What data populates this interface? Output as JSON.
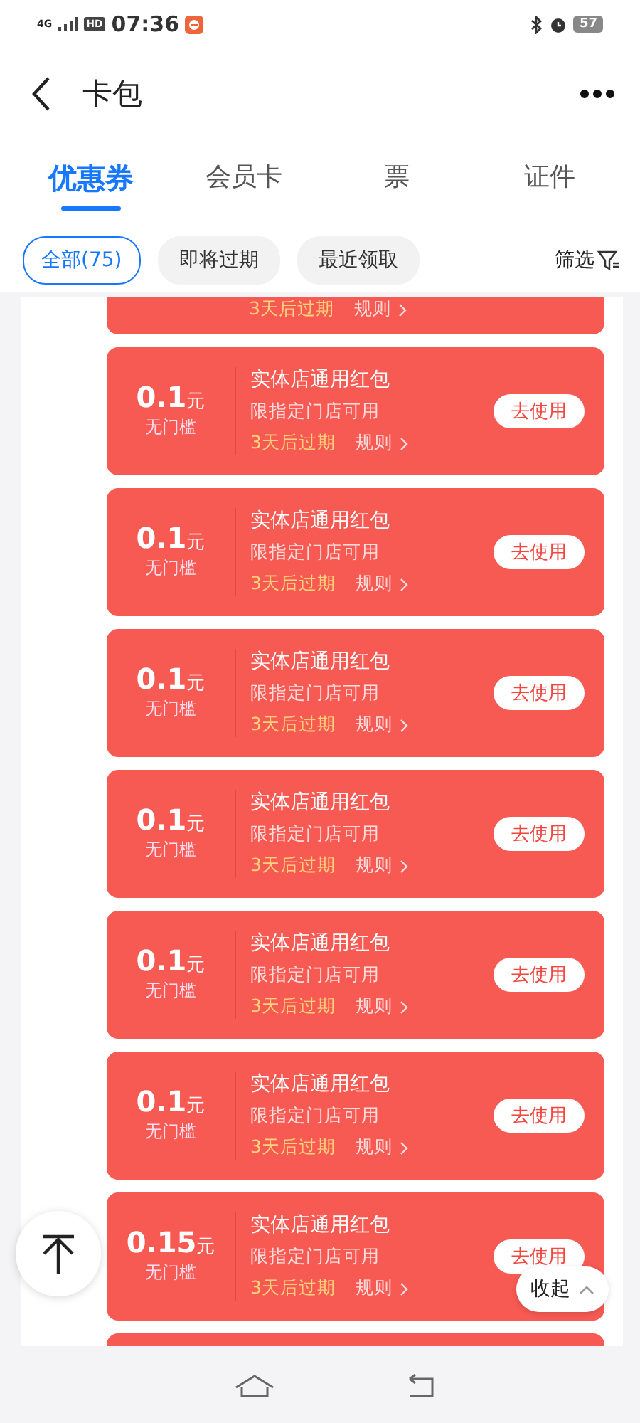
{
  "status_bar": {
    "network": "4G",
    "hd": "HD",
    "time": "07:36",
    "battery": "57"
  },
  "header": {
    "title": "卡包"
  },
  "tabs": [
    {
      "label": "优惠券",
      "selected": true
    },
    {
      "label": "会员卡",
      "selected": false
    },
    {
      "label": "票",
      "selected": false
    },
    {
      "label": "证件",
      "selected": false
    }
  ],
  "filters": [
    {
      "label": "全部(75)",
      "selected": true
    },
    {
      "label": "即将过期",
      "selected": false
    },
    {
      "label": "最近领取",
      "selected": false
    }
  ],
  "filter_button": "筛选",
  "coupons": [
    {
      "kind": "cut_top",
      "expiry": "3天后过期",
      "rules": "规则"
    },
    {
      "kind": "full",
      "amount": "0.1",
      "unit": "元",
      "threshold": "无门槛",
      "title": "实体店通用红包",
      "scope": "限指定门店可用",
      "expiry": "3天后过期",
      "rules": "规则",
      "action": "去使用"
    },
    {
      "kind": "full",
      "amount": "0.1",
      "unit": "元",
      "threshold": "无门槛",
      "title": "实体店通用红包",
      "scope": "限指定门店可用",
      "expiry": "3天后过期",
      "rules": "规则",
      "action": "去使用"
    },
    {
      "kind": "full",
      "amount": "0.1",
      "unit": "元",
      "threshold": "无门槛",
      "title": "实体店通用红包",
      "scope": "限指定门店可用",
      "expiry": "3天后过期",
      "rules": "规则",
      "action": "去使用"
    },
    {
      "kind": "full",
      "amount": "0.1",
      "unit": "元",
      "threshold": "无门槛",
      "title": "实体店通用红包",
      "scope": "限指定门店可用",
      "expiry": "3天后过期",
      "rules": "规则",
      "action": "去使用"
    },
    {
      "kind": "full",
      "amount": "0.1",
      "unit": "元",
      "threshold": "无门槛",
      "title": "实体店通用红包",
      "scope": "限指定门店可用",
      "expiry": "3天后过期",
      "rules": "规则",
      "action": "去使用"
    },
    {
      "kind": "full",
      "amount": "0.1",
      "unit": "元",
      "threshold": "无门槛",
      "title": "实体店通用红包",
      "scope": "限指定门店可用",
      "expiry": "3天后过期",
      "rules": "规则",
      "action": "去使用"
    },
    {
      "kind": "full",
      "amount": "0.15",
      "unit": "元",
      "threshold": "无门槛",
      "title": "实体店通用红包",
      "scope": "限指定门店可用",
      "expiry": "3天后过期",
      "rules": "规则",
      "action": "去使用"
    },
    {
      "kind": "cut_bottom"
    }
  ],
  "collapse_button": "收起"
}
